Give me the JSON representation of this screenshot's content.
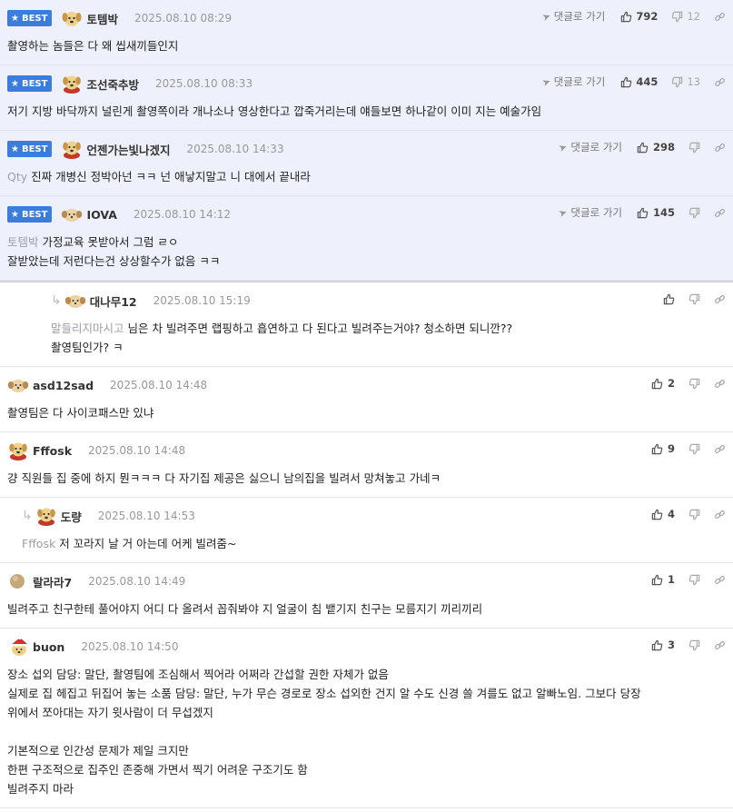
{
  "labels": {
    "best": "BEST",
    "goto_reply": "댓글로 가기"
  },
  "comments": [
    {
      "best": true,
      "avatar": "dog",
      "nick": "토템박",
      "date": "2025.08.10 08:29",
      "goto": true,
      "up": "792",
      "down": "12",
      "mention": "",
      "lines": [
        "촬영하는 놈들은 다 왜 씹새끼들인지"
      ]
    },
    {
      "best": true,
      "avatar": "dog-red",
      "nick": "조선죽추방",
      "date": "2025.08.10 08:33",
      "goto": true,
      "up": "445",
      "down": "13",
      "mention": "",
      "lines": [
        "저기 지방 바닥까지 널린게 촬영쪽이라 개나소나 영상한다고 깝죽거리는데 얘들보면 하나같이 이미 지는 예술가임"
      ]
    },
    {
      "best": true,
      "avatar": "dog-red",
      "nick": "언젠가는빛나겠지",
      "date": "2025.08.10 14:33",
      "goto": true,
      "up": "298",
      "down": "",
      "mention": "Qty",
      "lines": [
        "진짜 개병신 정박아넌 ㅋㅋ 넌 애낳지말고 니 대에서 끝내라"
      ]
    },
    {
      "best": true,
      "avatar": "puppy",
      "nick": "IOVA",
      "date": "2025.08.10 14:12",
      "goto": true,
      "up": "145",
      "down": "",
      "mention": "토템박",
      "lines": [
        "가정교육 못받아서 그럼 ㄹㅇ",
        "잘받았는데 저런다는건 상상할수가 없음 ㅋㅋ"
      ]
    },
    {
      "reply": 2,
      "avatar": "puppy",
      "nick": "대나무12",
      "date": "2025.08.10 15:19",
      "goto": false,
      "up": "",
      "down": "",
      "mention": "말들리지마시고",
      "lines": [
        "님은 차 빌려주면 랩핑하고 흡연하고 다 된다고 빌려주는거야? 청소하면 되니깐??",
        "촬영팀인가? ㅋ"
      ]
    },
    {
      "avatar": "puppy",
      "nick": "asd12sad",
      "date": "2025.08.10 14:48",
      "goto": false,
      "up": "2",
      "down": "",
      "mention": "",
      "lines": [
        "촬영팀은 다 사이코패스만 있냐"
      ]
    },
    {
      "avatar": "dog-red",
      "nick": "Fffosk",
      "date": "2025.08.10 14:48",
      "goto": false,
      "up": "9",
      "down": "",
      "mention": "",
      "lines": [
        "걍 직원들 집 중에 하지 뭔ㅋㅋㅋ 다 자기집 제공은 싫으니 남의집을 빌려서 망쳐놓고 가네ㅋ"
      ]
    },
    {
      "reply": 1,
      "avatar": "dog-red",
      "nick": "도량",
      "date": "2025.08.10 14:53",
      "goto": false,
      "up": "4",
      "down": "",
      "mention": "Fffosk",
      "lines": [
        "저 꼬라지 날 거 아는데 어케 빌려줌~"
      ]
    },
    {
      "avatar": "ball",
      "nick": "랄라라7",
      "date": "2025.08.10 14:49",
      "goto": false,
      "up": "1",
      "down": "",
      "mention": "",
      "lines": [
        "빌려주고 친구한테 풀어야지 어디 다 올려서 꼽줘봐야 지 얼굴이 침 뱉기지 친구는 모름지기 끼리끼리"
      ]
    },
    {
      "avatar": "santa",
      "nick": "buon",
      "date": "2025.08.10 14:50",
      "goto": false,
      "up": "3",
      "down": "",
      "mention": "",
      "lines": [
        "장소 섭외 담당: 말단, 촬영팀에 조심해서 찍어라 어쩌라 간섭할 권한 자체가 없음",
        "실제로 집 헤집고 뒤집어 놓는 소품 담당: 말단, 누가 무슨 경로로 장소 섭외한 건지 알 수도 신경 쓸 겨를도 없고 알빠노임. 그보다 당장",
        "위에서 쪼아대는 자기 윗사람이 더 무섭겠지",
        "",
        "기본적으로 인간성 문제가 제일 크지만",
        "한편 구조적으로 집주인 존중해 가면서 찍기 어려운 구조기도 함",
        "빌려주지 마라"
      ]
    }
  ]
}
